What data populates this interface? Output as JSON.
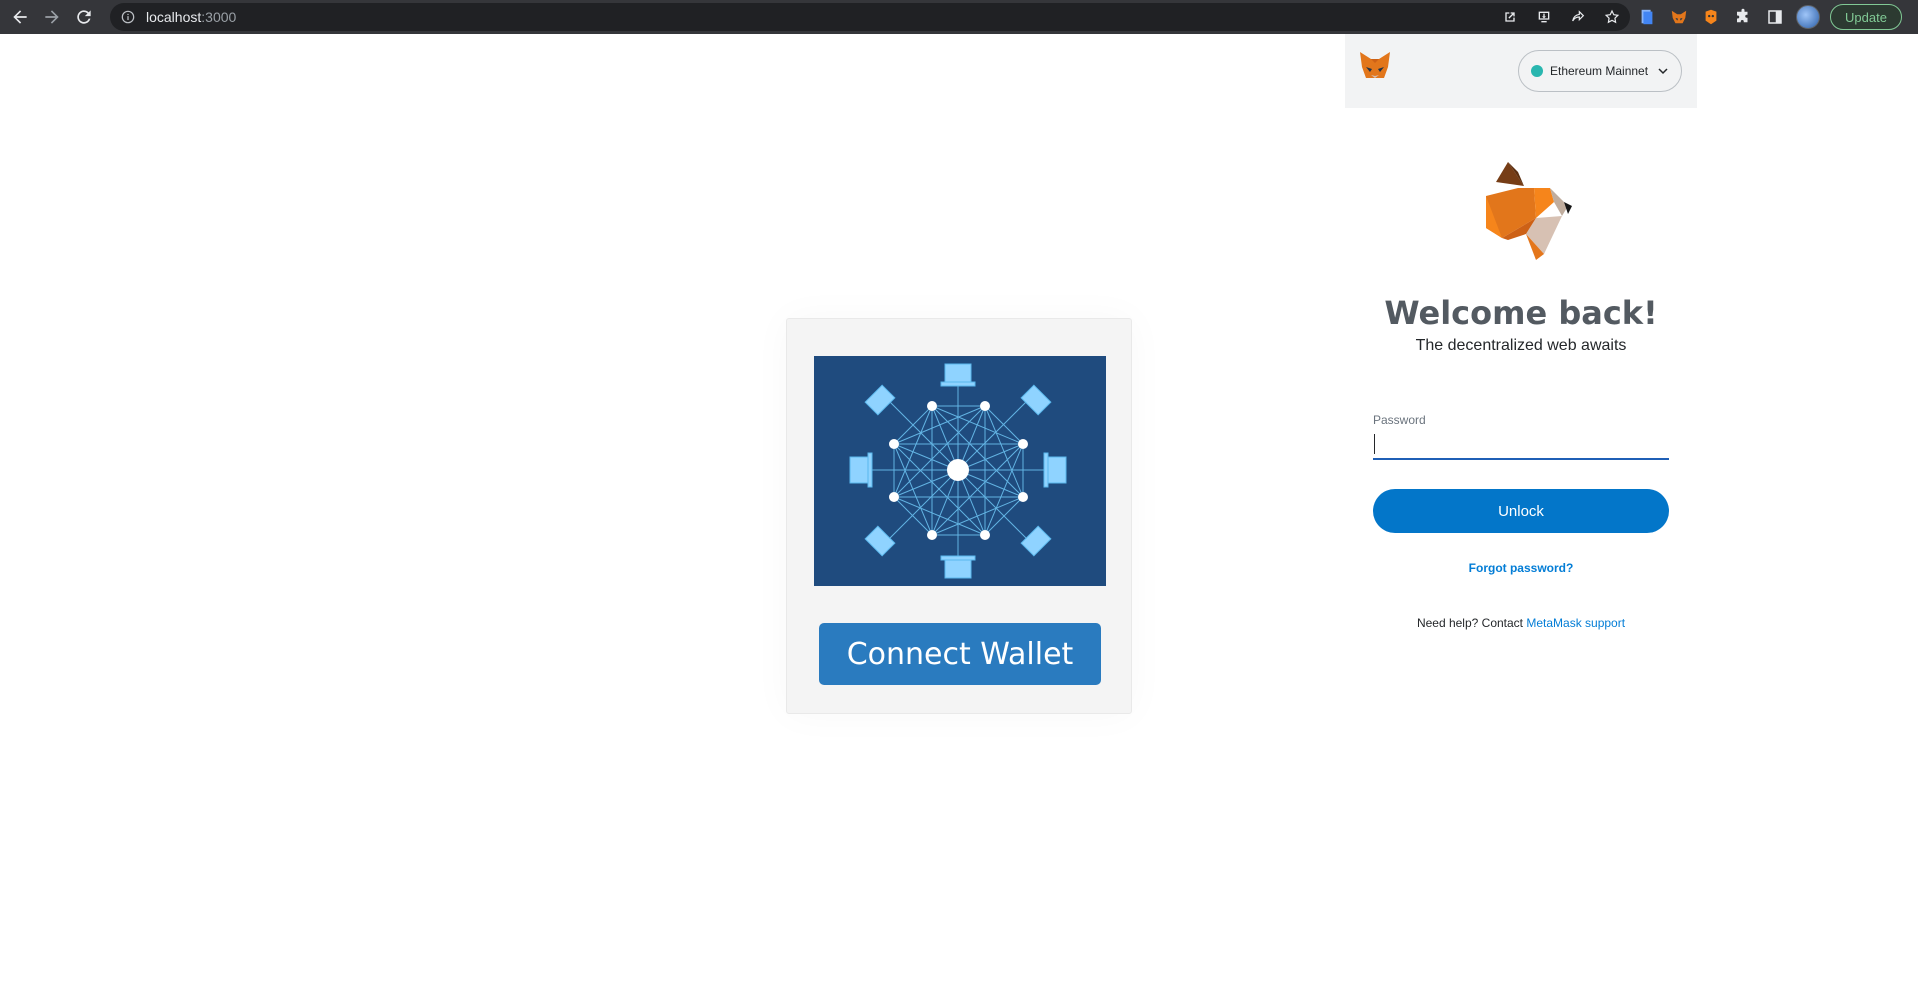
{
  "browser": {
    "url_host": "localhost",
    "url_port": ":3000",
    "update_label": "Update"
  },
  "page": {
    "connect_button_label": "Connect Wallet"
  },
  "metamask": {
    "network_label": "Ethereum Mainnet",
    "network_color": "#29b6af",
    "welcome_title": "Welcome back!",
    "tagline": "The decentralized web awaits",
    "password_label": "Password",
    "password_value": "",
    "unlock_label": "Unlock",
    "forgot_label": "Forgot password?",
    "help_prefix": "Need help? Contact ",
    "help_link": "MetaMask support"
  }
}
